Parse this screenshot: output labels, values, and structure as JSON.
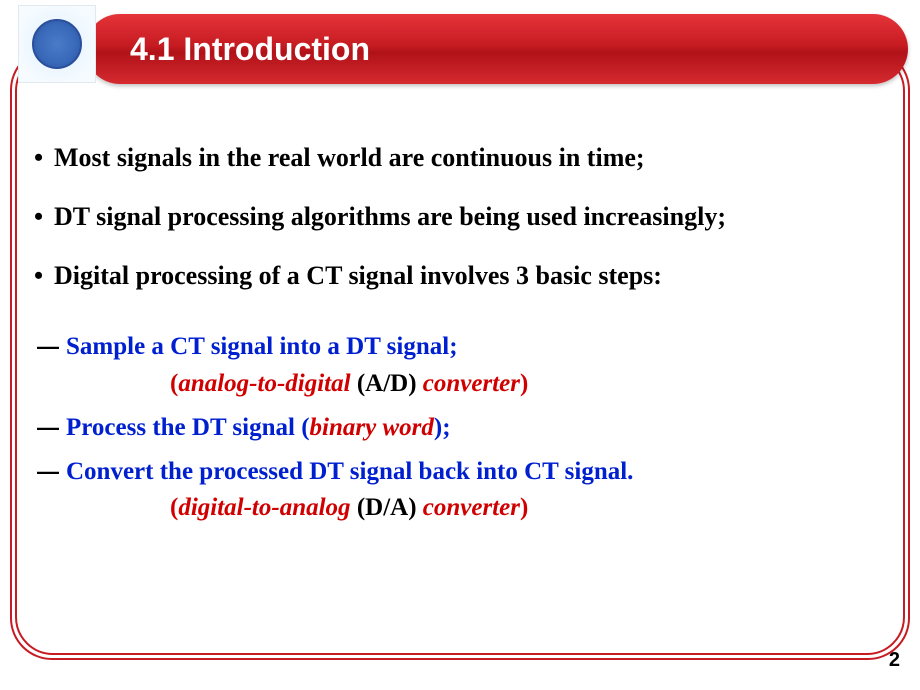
{
  "header": {
    "title": "4.1   Introduction"
  },
  "bullets": {
    "b1": "Most signals in the real world are continuous in time;",
    "b2": "DT signal processing algorithms are being used increasingly;",
    "b3": "Digital processing of a CT signal involves 3 basic steps:"
  },
  "steps": {
    "s1_main": "Sample a CT signal into a DT signal;",
    "s1_p_open": "(",
    "s1_p_ital": "analog-to-digital ",
    "s1_p_mid": "(A/D) ",
    "s1_p_conv": "converter",
    "s1_p_close": ")",
    "s2_main": "Process the DT signal ",
    "s2_p_open": "(",
    "s2_p_ital": "binary word",
    "s2_p_close": ");",
    "s3_main": "Convert the processed DT signal back into CT signal.",
    "s3_p_open": "(",
    "s3_p_ital": "digital-to-analog ",
    "s3_p_mid": "(D/A) ",
    "s3_p_conv": "converter",
    "s3_p_close": ")"
  },
  "page_number": "2",
  "glyphs": {
    "bullet": "•",
    "dash": "—"
  }
}
